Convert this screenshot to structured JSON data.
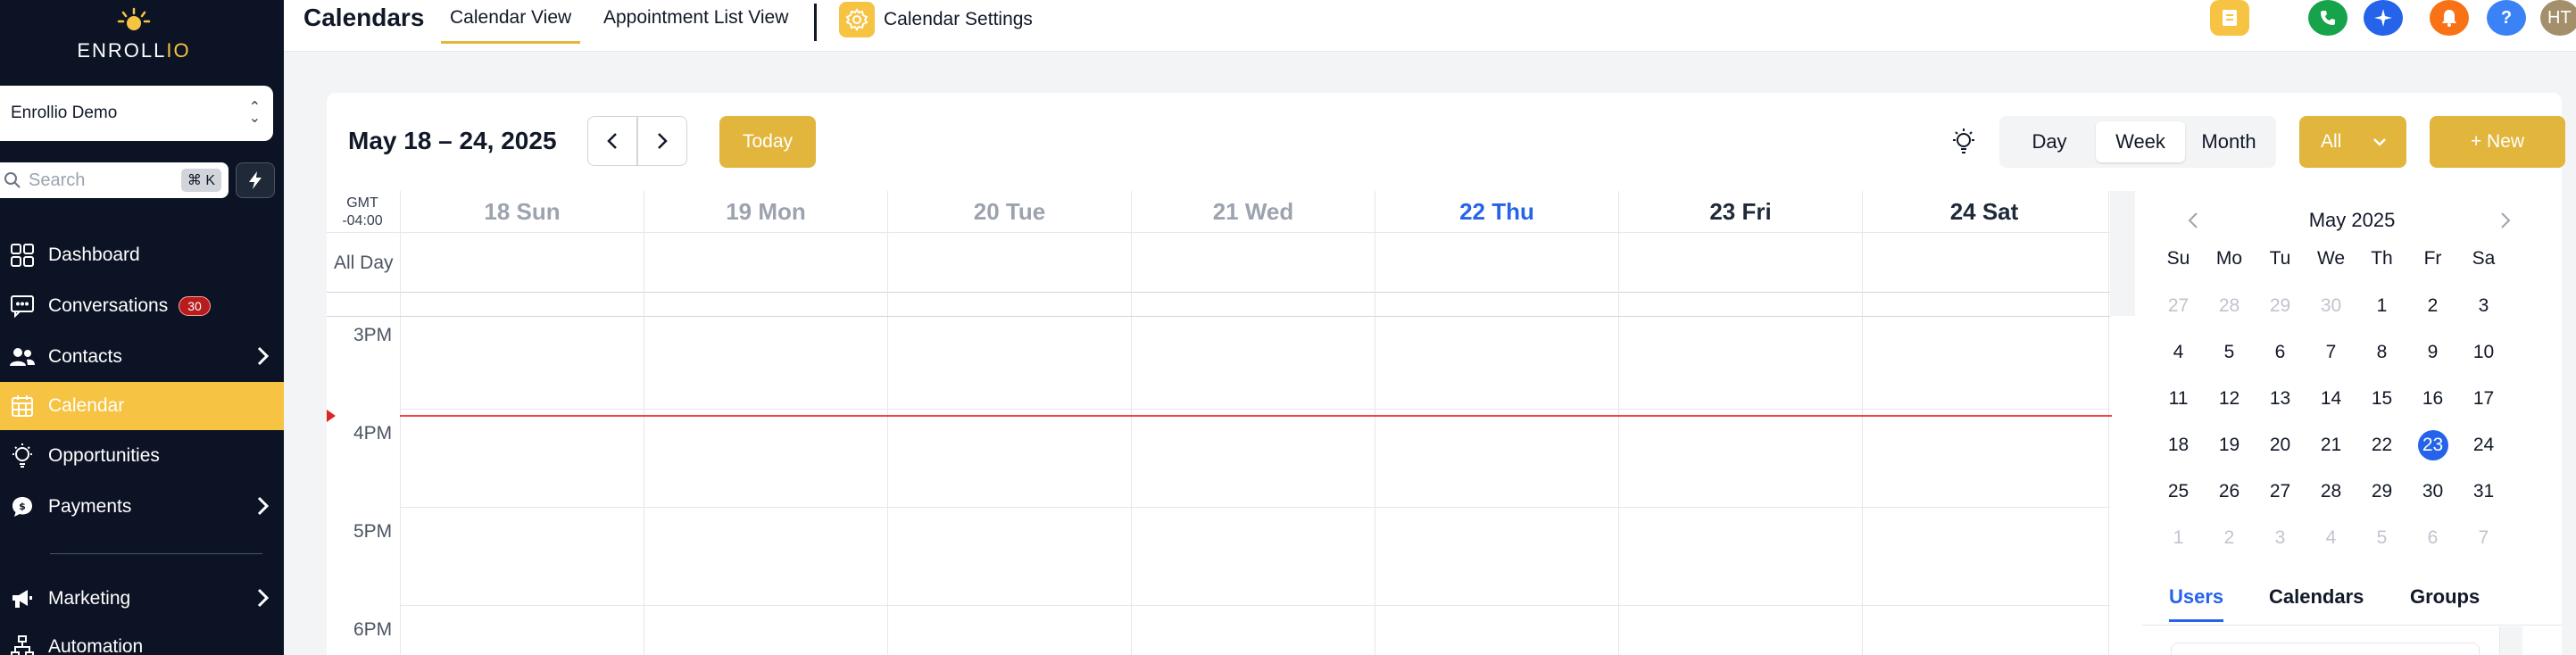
{
  "brand": {
    "logo_text_a": "ENROLL",
    "logo_text_b": "IO"
  },
  "sidebar": {
    "account_name": "Enrollio Demo",
    "search_placeholder": "Search",
    "search_shortcut": "⌘ K",
    "items": [
      {
        "label": "Dashboard"
      },
      {
        "label": "Conversations",
        "badge": "30"
      },
      {
        "label": "Contacts"
      },
      {
        "label": "Calendar"
      },
      {
        "label": "Opportunities"
      },
      {
        "label": "Payments"
      },
      {
        "label": "Marketing"
      },
      {
        "label": "Automation"
      }
    ]
  },
  "topbar": {
    "title": "Calendars",
    "tabs": [
      {
        "label": "Calendar View"
      },
      {
        "label": "Appointment List View"
      }
    ],
    "settings_label": "Calendar Settings",
    "help_label": "?",
    "avatar_initials": "HT",
    "colors": {
      "note": "#f6c342",
      "phone": "#16a34a",
      "ai": "#2563eb",
      "bell": "#f97316",
      "help": "#3b82f6",
      "avatar": "#a38f6a"
    }
  },
  "toolbar": {
    "date_range": "May 18 – 24, 2025",
    "today_label": "Today",
    "views": [
      {
        "label": "Day"
      },
      {
        "label": "Week"
      },
      {
        "label": "Month"
      }
    ],
    "active_view": "Week",
    "filter_label": "All",
    "new_label": "+ New"
  },
  "calendar": {
    "timezone_line1": "GMT",
    "timezone_line2": "-04:00",
    "allday_label": "All Day",
    "days": [
      {
        "label": "18 Sun",
        "state": "past"
      },
      {
        "label": "19 Mon",
        "state": "past"
      },
      {
        "label": "20 Tue",
        "state": "past"
      },
      {
        "label": "21 Wed",
        "state": "past"
      },
      {
        "label": "22 Thu",
        "state": "today"
      },
      {
        "label": "23 Fri",
        "state": "future"
      },
      {
        "label": "24 Sat",
        "state": "future"
      }
    ],
    "hours": [
      {
        "label": "3PM"
      },
      {
        "label": "4PM"
      },
      {
        "label": "5PM"
      },
      {
        "label": "6PM"
      }
    ]
  },
  "mini_calendar": {
    "month_label": "May 2025",
    "weekdays": [
      "Su",
      "Mo",
      "Tu",
      "We",
      "Th",
      "Fr",
      "Sa"
    ],
    "weeks": [
      [
        "27",
        "28",
        "29",
        "30",
        "1",
        "2",
        "3"
      ],
      [
        "4",
        "5",
        "6",
        "7",
        "8",
        "9",
        "10"
      ],
      [
        "11",
        "12",
        "13",
        "14",
        "15",
        "16",
        "17"
      ],
      [
        "18",
        "19",
        "20",
        "21",
        "22",
        "23",
        "24"
      ],
      [
        "25",
        "26",
        "27",
        "28",
        "29",
        "30",
        "31"
      ],
      [
        "1",
        "2",
        "3",
        "4",
        "5",
        "6",
        "7"
      ]
    ],
    "selected": "23"
  },
  "panel_tabs": [
    {
      "label": "Users"
    },
    {
      "label": "Calendars"
    },
    {
      "label": "Groups"
    }
  ]
}
